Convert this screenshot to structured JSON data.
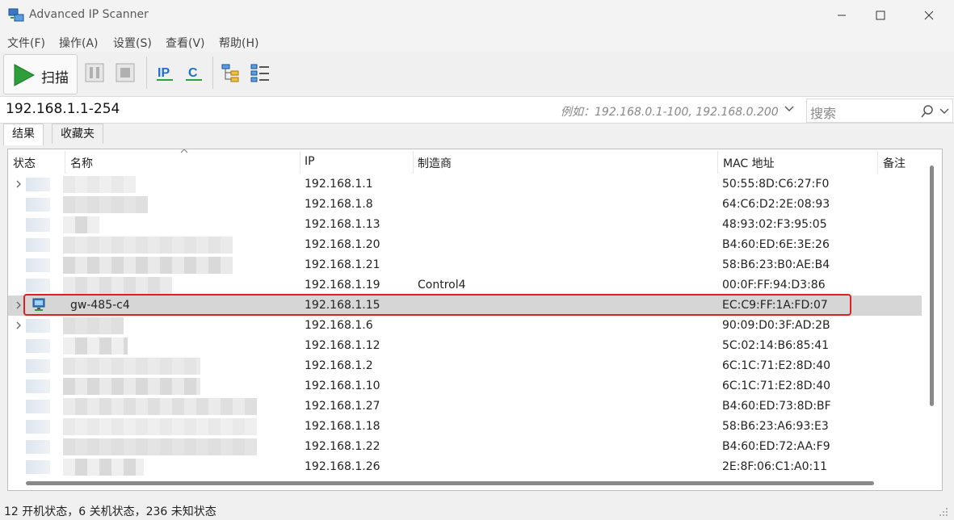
{
  "window": {
    "title": "Advanced IP Scanner"
  },
  "menu": [
    "文件(F)",
    "操作(A)",
    "设置(S)",
    "查看(V)",
    "帮助(H)"
  ],
  "toolbar": {
    "scan_label": "扫描",
    "ip_button": "IP",
    "c_button": "C",
    "icons": [
      "play-icon",
      "pause-icon",
      "stop-icon",
      "ip-icon",
      "c-class-icon",
      "tree-icon",
      "list-icon"
    ]
  },
  "address": {
    "ip_range": "192.168.1.1-254",
    "example": "例如：192.168.0.1-100, 192.168.0.200",
    "search_placeholder": "搜索"
  },
  "tabs": [
    "结果",
    "收藏夹"
  ],
  "columns": [
    "状态",
    "名称",
    "IP",
    "制造商",
    "MAC 地址",
    "备注"
  ],
  "rows": [
    {
      "name": "",
      "ip": "192.168.1.1",
      "vendor": "",
      "mac": "50:55:8D:C6:27:F0",
      "expand": true,
      "selected": false
    },
    {
      "name": "",
      "ip": "192.168.1.8",
      "vendor": "",
      "mac": "64:C6:D2:2E:08:93",
      "expand": false,
      "selected": false
    },
    {
      "name": "",
      "ip": "192.168.1.13",
      "vendor": "",
      "mac": "48:93:02:F3:95:05",
      "expand": false,
      "selected": false
    },
    {
      "name": "",
      "ip": "192.168.1.20",
      "vendor": "",
      "mac": "B4:60:ED:6E:3E:26",
      "expand": false,
      "selected": false
    },
    {
      "name": "",
      "ip": "192.168.1.21",
      "vendor": "",
      "mac": "58:B6:23:B0:AE:B4",
      "expand": false,
      "selected": false
    },
    {
      "name": "",
      "ip": "192.168.1.19",
      "vendor": "Control4",
      "mac": "00:0F:FF:94:D3:86",
      "expand": false,
      "selected": false
    },
    {
      "name": "gw-485-c4",
      "ip": "192.168.1.15",
      "vendor": "",
      "mac": "EC:C9:FF:1A:FD:07",
      "expand": true,
      "selected": true
    },
    {
      "name": "",
      "ip": "192.168.1.6",
      "vendor": "",
      "mac": "90:09:D0:3F:AD:2B",
      "expand": true,
      "selected": false
    },
    {
      "name": "",
      "ip": "192.168.1.12",
      "vendor": "",
      "mac": "5C:02:14:B6:85:41",
      "expand": false,
      "selected": false
    },
    {
      "name": "",
      "ip": "192.168.1.2",
      "vendor": "",
      "mac": "6C:1C:71:E2:8D:40",
      "expand": false,
      "selected": false
    },
    {
      "name": "",
      "ip": "192.168.1.10",
      "vendor": "",
      "mac": "6C:1C:71:E2:8D:40",
      "expand": false,
      "selected": false
    },
    {
      "name": "",
      "ip": "192.168.1.27",
      "vendor": "",
      "mac": "B4:60:ED:73:8D:BF",
      "expand": false,
      "selected": false
    },
    {
      "name": "",
      "ip": "192.168.1.18",
      "vendor": "",
      "mac": "58:B6:23:A6:93:E3",
      "expand": false,
      "selected": false
    },
    {
      "name": "",
      "ip": "192.168.1.22",
      "vendor": "",
      "mac": "B4:60:ED:72:AA:F9",
      "expand": false,
      "selected": false
    },
    {
      "name": "",
      "ip": "192.168.1.26",
      "vendor": "",
      "mac": "2E:8F:06:C1:A0:11",
      "expand": false,
      "selected": false
    }
  ],
  "status": "12 开机状态，6 关机状态，236 未知状态",
  "colors": {
    "selection": "#d6d6d6",
    "highlight_outline": "#e02020",
    "scan_green": "#2e9e3a",
    "accent_blue": "#1f6fcf"
  }
}
